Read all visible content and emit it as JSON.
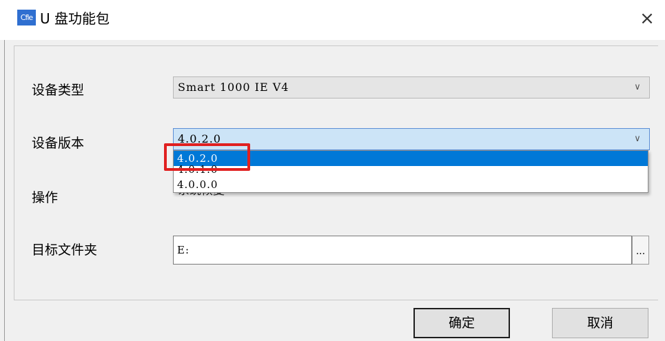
{
  "window": {
    "app_icon_text": "Cfle",
    "title": "U 盘功能包",
    "close_glyph": "×"
  },
  "form": {
    "device_type": {
      "label": "设备类型",
      "value": "Smart 1000 IE V4",
      "chevron": "∨"
    },
    "device_version": {
      "label": "设备版本",
      "value": "4.0.2.0",
      "chevron": "∨",
      "options": [
        "4.0.2.0",
        "4.0.1.0",
        "4.0.0.0"
      ],
      "selected_option": "4.0.2.0"
    },
    "operation": {
      "label": "操作",
      "value": "系统恢复",
      "chevron": "∨"
    },
    "target_folder": {
      "label": "目标文件夹",
      "value": "E:",
      "browse_label": "..."
    }
  },
  "buttons": {
    "ok": "确定",
    "cancel": "取消"
  },
  "annotation": {
    "highlight_color": "#e02020"
  }
}
